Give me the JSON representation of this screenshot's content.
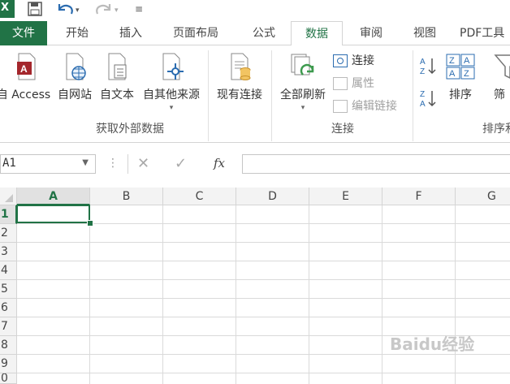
{
  "tabs": [
    {
      "label": "文件"
    },
    {
      "label": "开始"
    },
    {
      "label": "插入"
    },
    {
      "label": "页面布局"
    },
    {
      "label": "公式"
    },
    {
      "label": "数据"
    },
    {
      "label": "审阅"
    },
    {
      "label": "视图"
    },
    {
      "label": "PDF工具"
    }
  ],
  "ribbon": {
    "get_external": {
      "access": "自 Access",
      "web": "自网站",
      "text": "自文本",
      "other": "自其他来源",
      "group_label": "获取外部数据"
    },
    "existing": "现有连接",
    "connections": {
      "refresh_all": "全部刷新",
      "connections": "连接",
      "properties": "属性",
      "edit_links": "编辑链接",
      "group_label": "连接"
    },
    "sort": {
      "sort": "排序",
      "filter": "筛",
      "group_label": "排序和"
    }
  },
  "formula_bar": {
    "name_box": "A1",
    "fx": "fx",
    "formula_value": ""
  },
  "columns": [
    "A",
    "B",
    "C",
    "D",
    "E",
    "F",
    "G"
  ],
  "rows": [
    "1",
    "2",
    "3",
    "4",
    "5",
    "6",
    "7",
    "8",
    "9",
    "0"
  ],
  "watermark": "Baidu经验",
  "colors": {
    "accent": "#217346"
  }
}
